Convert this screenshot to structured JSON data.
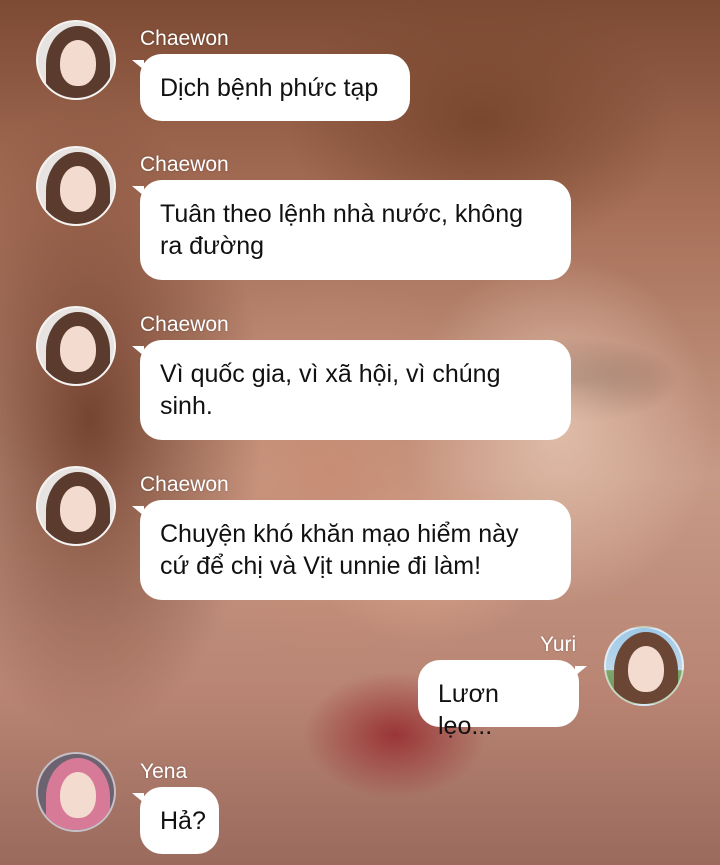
{
  "messages": [
    {
      "sender": "Chaewon",
      "side": "left",
      "avatar": "chaewon-avatar",
      "text": "Dịch bệnh phức tạp"
    },
    {
      "sender": "Chaewon",
      "side": "left",
      "avatar": "chaewon-avatar",
      "text": "Tuân theo lệnh nhà nước, không ra đường"
    },
    {
      "sender": "Chaewon",
      "side": "left",
      "avatar": "chaewon-avatar",
      "text": "Vì quốc gia, vì xã hội, vì chúng sinh."
    },
    {
      "sender": "Chaewon",
      "side": "left",
      "avatar": "chaewon-avatar",
      "text": "Chuyện khó khăn mạo hiểm này cứ để chị và Vịt unnie đi làm!"
    },
    {
      "sender": "Yuri",
      "side": "right",
      "avatar": "yuri-avatar",
      "text": "Lươn lẹo..."
    },
    {
      "sender": "Yena",
      "side": "left",
      "avatar": "yena-avatar",
      "text": "Hả?"
    }
  ]
}
